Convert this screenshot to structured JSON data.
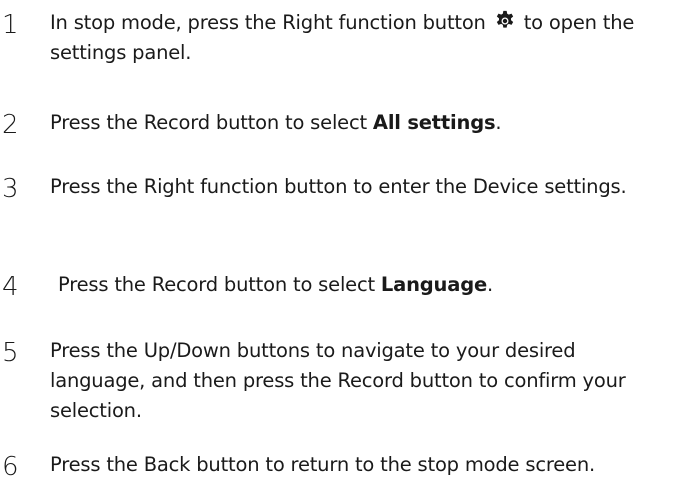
{
  "steps": [
    {
      "number": "1",
      "text_before": "In stop mode, press the Right function button",
      "icon": "gear-icon",
      "text_after": "to open the settings panel."
    },
    {
      "number": "2",
      "text_before": "Press the Record button to select ",
      "bold": "All settings",
      "text_after": "."
    },
    {
      "number": "3",
      "text": "Press the Right function button to enter the Device settings."
    },
    {
      "number": "4",
      "text_before": "Press the Record button to select ",
      "bold": "Language",
      "text_after": "."
    },
    {
      "number": "5",
      "text": "Press the Up/Down buttons to navigate to your desired language, and then press the Record button to confirm your selection."
    },
    {
      "number": "6",
      "text": "Press the Back button to return to the stop mode screen."
    }
  ]
}
